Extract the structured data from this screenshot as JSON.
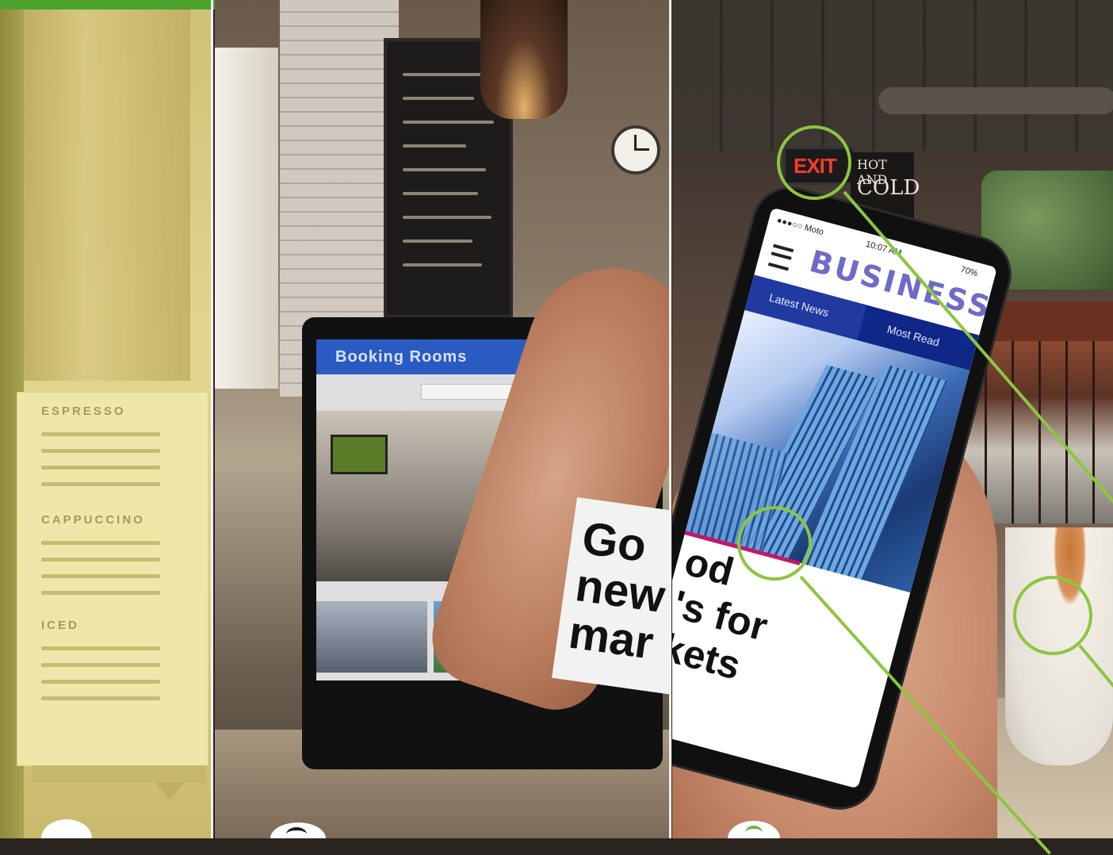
{
  "left_panel": {
    "menu_sections": [
      {
        "name": "ESPRESSO"
      },
      {
        "name": "CAPPUCCINO"
      },
      {
        "name": "ICED"
      }
    ]
  },
  "middle_panel": {
    "laptop_title": "Booking Rooms",
    "card_text_lines": [
      "Go",
      "new",
      "mar"
    ]
  },
  "right_panel": {
    "exit_sign": "EXIT",
    "hot_cold_sign": [
      "HOT AND",
      "COLD"
    ],
    "phone": {
      "carrier": "●●●○○ Moto",
      "time": "10:07 AM",
      "battery": "70%",
      "app_title": "BUSINESS",
      "tabs": [
        "Latest News",
        "Most Read"
      ],
      "headline_lines": [
        "od",
        "'s for",
        "kets"
      ]
    }
  },
  "colors": {
    "accent": "#8cc63f",
    "nav_blue": "#0f2787",
    "title_purple": "#6f6bc8",
    "exit_red": "#ff3a2a"
  }
}
